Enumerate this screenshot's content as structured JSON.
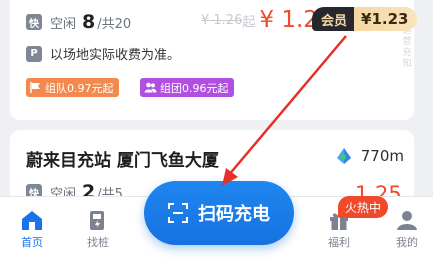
{
  "card1": {
    "tag": "快",
    "status_label": "空闲",
    "free_count": "8",
    "total_label": "/共20",
    "price_old": "¥ 1.26",
    "price_old_unit": "起",
    "price": "¥ 1.25",
    "price_unit": "起",
    "member_label": "会员",
    "member_price": "¥1.23",
    "parking_tag": "P",
    "parking_note": "以场地实际收费为准。",
    "badge_team": "组队0.97元起",
    "badge_group": "组团0.96元起",
    "side_text": "运营充知"
  },
  "card2": {
    "title": "蔚来目充站 厦门飞鱼大厦",
    "distance": "770m",
    "tag": "快",
    "status_label": "空闲",
    "free_count": "2",
    "total_label": "/共5",
    "price_partial": "1.25"
  },
  "tabbar": {
    "items": [
      {
        "label": "首页",
        "icon": "home-icon"
      },
      {
        "label": "找桩",
        "icon": "charger-icon"
      },
      {
        "label": "福利",
        "icon": "gift-icon"
      },
      {
        "label": "我的",
        "icon": "user-icon"
      }
    ],
    "scan_label": "扫码充电",
    "hot_badge": "火热中"
  },
  "colors": {
    "accent": "#1a73e8",
    "price": "#f04a2a",
    "annotation_arrow": "#e5302a"
  }
}
